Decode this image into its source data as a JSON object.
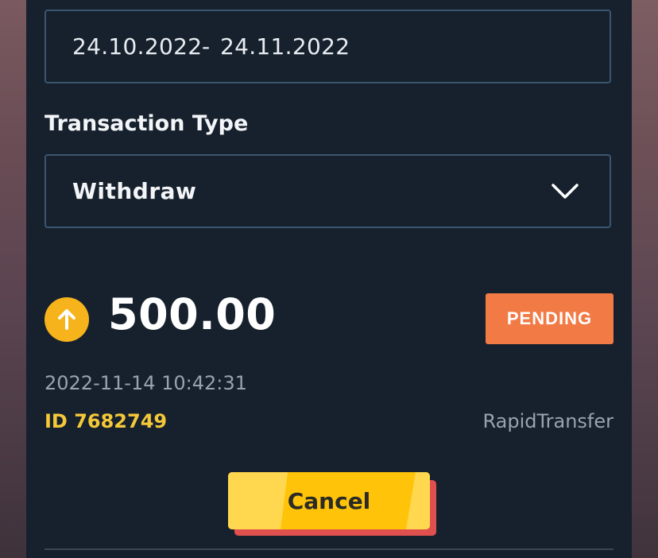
{
  "filters": {
    "date_from": "24.10.2022",
    "date_separator": "-",
    "date_to": "24.11.2022",
    "transaction_type_label": "Transaction Type",
    "transaction_type_value": "Withdraw"
  },
  "transaction": {
    "direction_icon": "arrow-up-icon",
    "amount": "500.00",
    "status": "PENDING",
    "timestamp": "2022-11-14 10:42:31",
    "id_text": "ID 7682749",
    "method": "RapidTransfer"
  },
  "actions": {
    "cancel_label": "Cancel"
  },
  "colors": {
    "panel_bg": "#17212d",
    "field_border": "#3b5570",
    "status_pending": "#f27a45",
    "coin": "#f6b31b",
    "id_text": "#f4c838",
    "button_face": "#ffc40a",
    "button_shadow": "#e0504f"
  }
}
